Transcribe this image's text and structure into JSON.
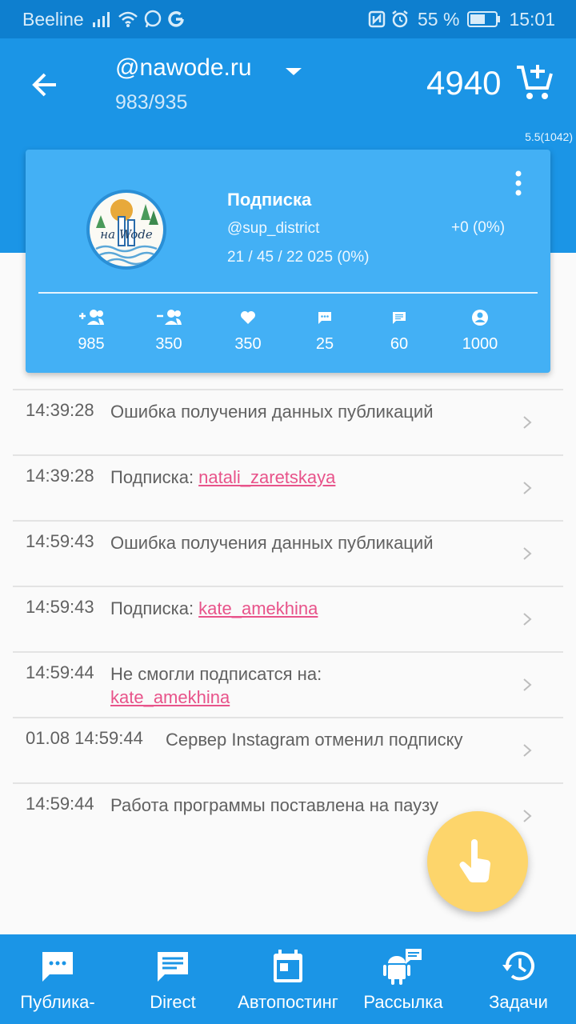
{
  "status_bar": {
    "carrier": "Beeline",
    "battery": "55 %",
    "time": "15:01",
    "icons": [
      "signal-icon",
      "wifi-icon",
      "whatsapp-icon",
      "google-icon",
      "nfc-icon",
      "alarm-icon",
      "battery-icon"
    ]
  },
  "header": {
    "account": "@nawode.ru",
    "counts": "983/935",
    "balance": "4940",
    "version": "5.5(1042)"
  },
  "card": {
    "logo_text": "на Wode",
    "task_title": "Подписка",
    "source_user": "@sup_district",
    "progress": "21 / 45 / 22 025 (0%)",
    "delta": "+0 (0%)",
    "stats": [
      {
        "icon": "follow-icon",
        "value": "985"
      },
      {
        "icon": "unfollow-icon",
        "value": "350"
      },
      {
        "icon": "like-icon",
        "value": "350"
      },
      {
        "icon": "comment-icon",
        "value": "25"
      },
      {
        "icon": "message-icon",
        "value": "60"
      },
      {
        "icon": "profile-icon",
        "value": "1000"
      }
    ]
  },
  "log": [
    {
      "time": "14:39:28",
      "text": "Ошибка получения данных публикаций",
      "link": ""
    },
    {
      "time": "14:39:28",
      "text": "Подписка: ",
      "link": "natali_zaretskaya"
    },
    {
      "time": "14:59:43",
      "text": "Ошибка получения данных публикаций",
      "link": ""
    },
    {
      "time": "14:59:43",
      "text": "Подписка: ",
      "link": "kate_amekhina"
    },
    {
      "time": "14:59:44",
      "text": "Не смогли подписатся на: ",
      "link": "kate_amekhina"
    },
    {
      "time": "01.08 14:59:44",
      "text": "Сервер Instagram отменил подписку",
      "link": ""
    },
    {
      "time": "14:59:44",
      "text": "Работа программы поставлена на паузу",
      "link": ""
    }
  ],
  "bottom_nav": [
    {
      "label": "Публика-",
      "icon": "publications-icon"
    },
    {
      "label": "Direct",
      "icon": "direct-icon"
    },
    {
      "label": "Автопостинг",
      "icon": "calendar-icon"
    },
    {
      "label": "Рассылка",
      "icon": "android-icon"
    },
    {
      "label": "Задачи",
      "icon": "history-icon"
    }
  ],
  "colors": {
    "primary": "#1b95e6",
    "status_bar": "#0e7fcf",
    "card": "#43b0f5",
    "link": "#e8538a",
    "fab": "#fdd56b"
  }
}
